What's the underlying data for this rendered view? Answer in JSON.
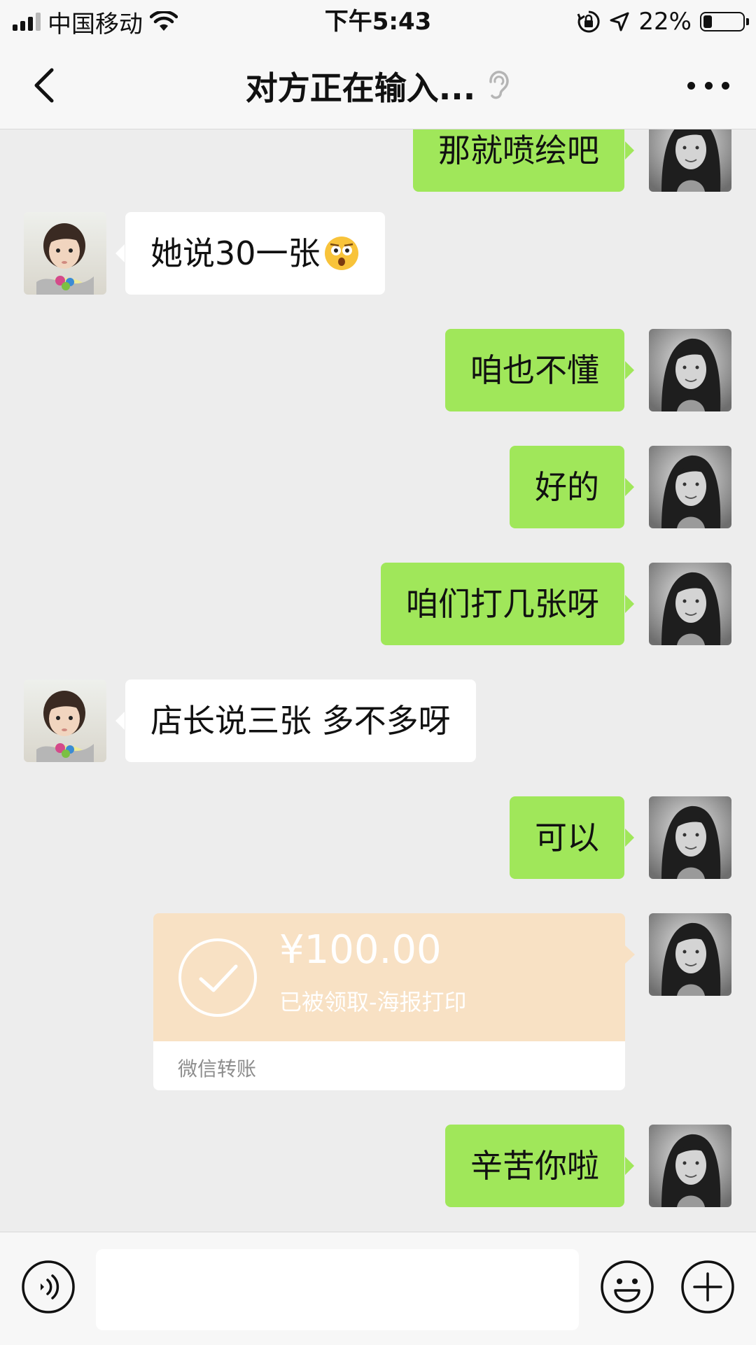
{
  "status_bar": {
    "carrier": "中国移动",
    "time": "下午5:43",
    "battery_percent": "22%",
    "battery_level": 0.22,
    "icons": [
      "signal-icon",
      "wifi-icon",
      "rotation-lock-icon",
      "location-icon",
      "battery-icon"
    ]
  },
  "nav": {
    "title": "对方正在输入...",
    "back_icon": "chevron-left-icon",
    "ear_icon": "ear-icon",
    "more_icon": "more-icon"
  },
  "messages": [
    {
      "side": "me",
      "text": "那就喷绘吧",
      "partial": true
    },
    {
      "side": "other",
      "text": "她说30一张",
      "emoji": "astonished-emoji-icon"
    },
    {
      "side": "me",
      "text": "咱也不懂"
    },
    {
      "side": "me",
      "text": "好的"
    },
    {
      "side": "me",
      "text": "咱们打几张呀"
    },
    {
      "side": "other",
      "text": "店长说三张 多不多呀"
    },
    {
      "side": "me",
      "text": "可以"
    },
    {
      "side": "me",
      "type": "transfer",
      "amount": "¥100.00",
      "status": "已被领取-海报打印",
      "caption": "微信转账"
    },
    {
      "side": "me",
      "text": "辛苦你啦"
    }
  ],
  "input_bar": {
    "voice_icon": "voice-icon",
    "input_value": "",
    "emoji_icon": "emoji-icon",
    "plus_icon": "plus-icon"
  },
  "colors": {
    "my_bubble": "#a0e75a",
    "other_bubble": "#ffffff",
    "transfer": "#f8e1c4",
    "background": "#ededed"
  }
}
